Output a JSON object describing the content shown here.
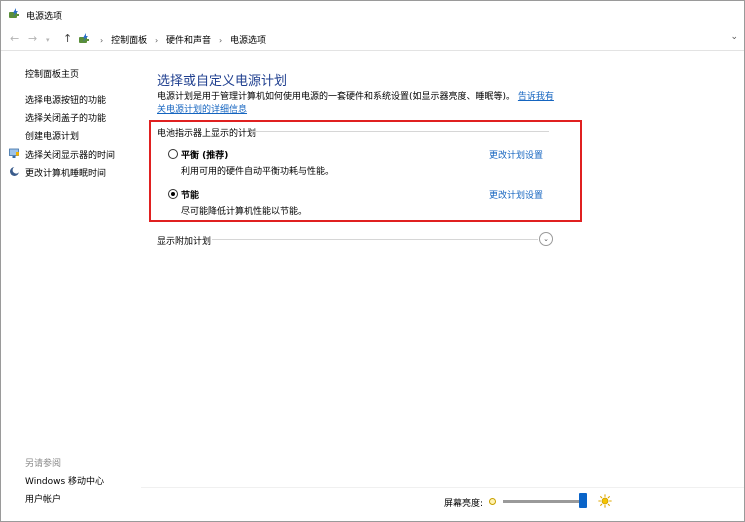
{
  "window": {
    "title": "电源选项",
    "app_icon": "power-options-icon"
  },
  "address_bar": {
    "breadcrumbs": [
      "控制面板",
      "硬件和声音",
      "电源选项"
    ],
    "location_icon": "control-panel-icon",
    "back_icon": "arrow-left-icon",
    "forward_icon": "arrow-right-icon",
    "recent_icon": "chevron-down-icon",
    "up_icon": "arrow-up-icon",
    "dropdown_icon": "chevron-down-icon"
  },
  "sidebar": {
    "home": "控制面板主页",
    "items": [
      {
        "label": "选择电源按钮的功能",
        "icon": null
      },
      {
        "label": "选择关闭盖子的功能",
        "icon": null
      },
      {
        "label": "创建电源计划",
        "icon": null
      },
      {
        "label": "选择关闭显示器的时间",
        "icon": "monitor-shield-icon"
      },
      {
        "label": "更改计算机睡眠时间",
        "icon": "moon-icon"
      }
    ],
    "see_also": {
      "heading": "另请参阅",
      "links": [
        "Windows 移动中心",
        "用户帐户"
      ]
    }
  },
  "main": {
    "title": "选择或自定义电源计划",
    "description": "电源计划是用于管理计算机如何使用电源的一套硬件和系统设置(如显示器亮度、睡眠等)。",
    "description_link": "告诉我有关电源计划的详细信息",
    "group_header": "电池指示器上显示的计划",
    "plans": [
      {
        "name": "平衡 (推荐)",
        "description": "利用可用的硬件自动平衡功耗与性能。",
        "link": "更改计划设置",
        "selected": false
      },
      {
        "name": "节能",
        "description": "尽可能降低计算机性能以节能。",
        "link": "更改计划设置",
        "selected": true
      }
    ],
    "more_plans": "显示附加计划",
    "expand_icon": "chevron-down-icon"
  },
  "brightness": {
    "label": "屏幕亮度:",
    "level_fraction": 0.98,
    "dim_icon": "sun-dim-icon",
    "bright_icon": "sun-bright-icon"
  },
  "colors": {
    "accent": "#1565c0",
    "title": "#1f3f8f",
    "highlight_box": "#e02020",
    "slider_thumb": "#0a64c8"
  }
}
